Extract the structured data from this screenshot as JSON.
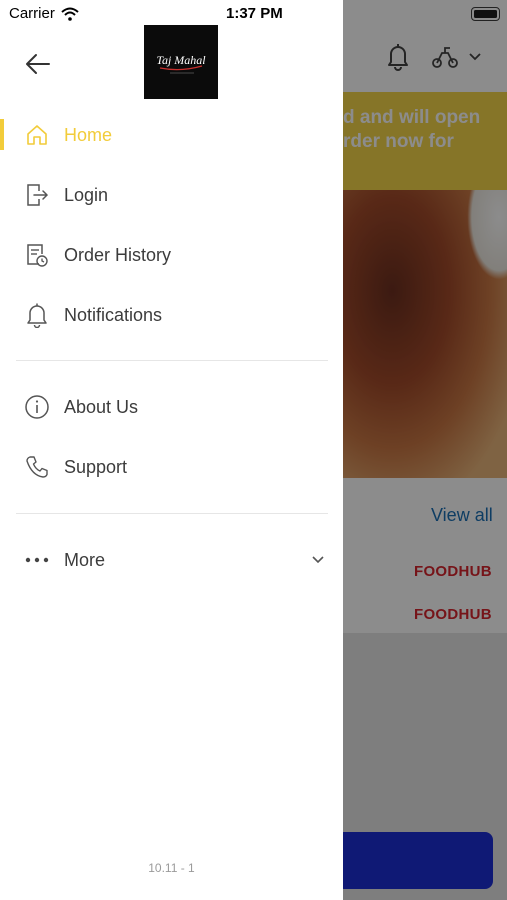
{
  "status_bar": {
    "carrier": "Carrier",
    "time": "1:37 PM"
  },
  "background": {
    "banner_text_line1": "d and will open",
    "banner_text_line2": "rder now for",
    "view_all": "View all",
    "partner_logos": [
      "FOODHUB",
      "FOODHUB"
    ]
  },
  "drawer": {
    "logo_text": "Taj Mahal",
    "menu": [
      {
        "label": "Home",
        "icon": "home-icon",
        "active": true
      },
      {
        "label": "Login",
        "icon": "login-icon",
        "active": false
      },
      {
        "label": "Order History",
        "icon": "order-history-icon",
        "active": false
      },
      {
        "label": "Notifications",
        "icon": "bell-icon",
        "active": false
      }
    ],
    "secondary_menu": [
      {
        "label": "About Us",
        "icon": "info-icon"
      },
      {
        "label": "Support",
        "icon": "phone-icon"
      }
    ],
    "more_label": "More",
    "version": "10.11 - 1"
  },
  "colors": {
    "accent": "#f2cc3a",
    "text": "#3c3c3c",
    "link": "#1a6fb5",
    "brand_red": "#d8262e",
    "cta_blue": "#1d2fd6"
  }
}
